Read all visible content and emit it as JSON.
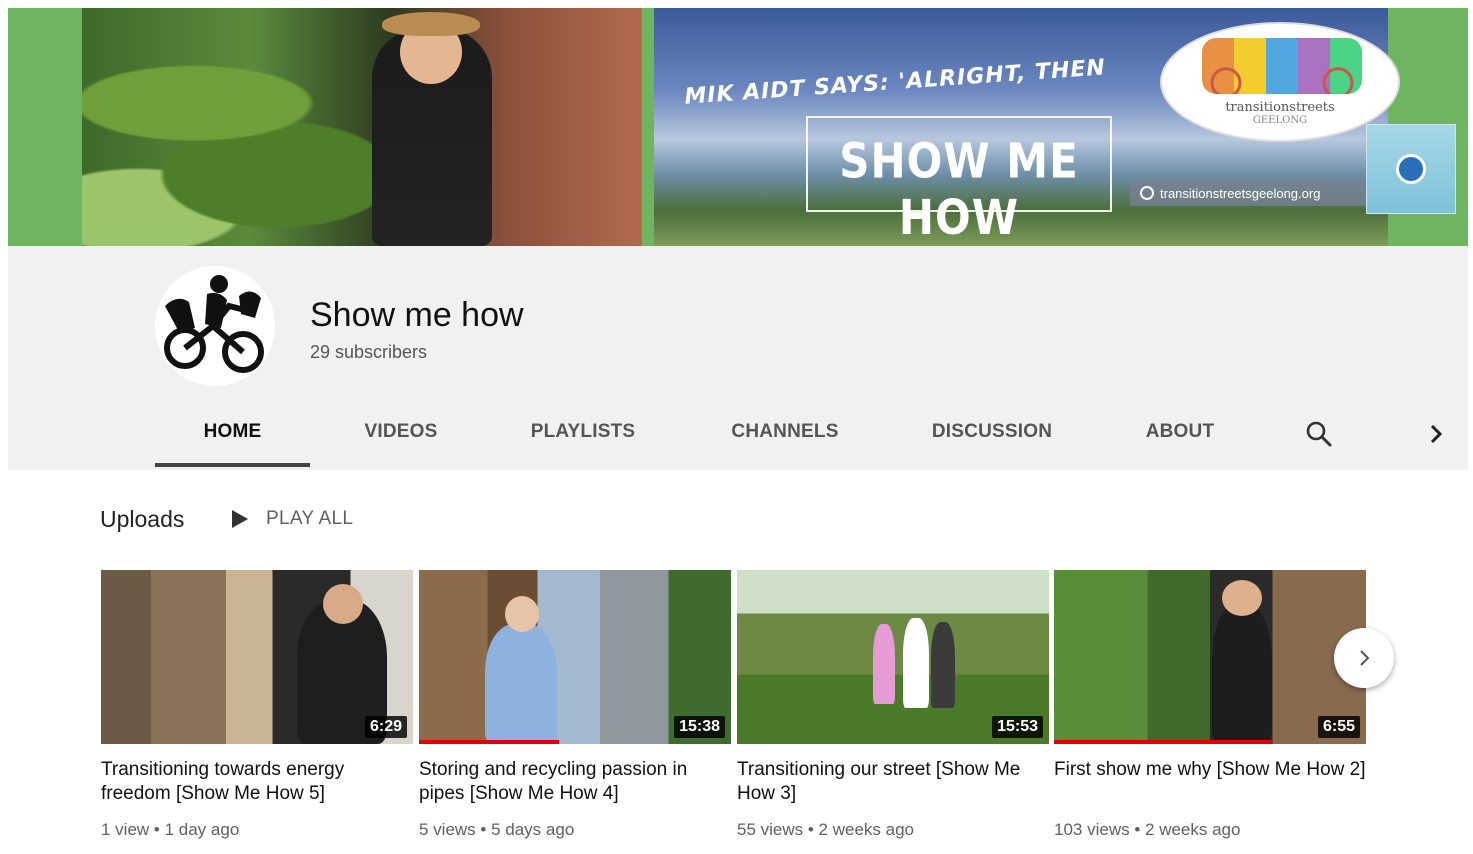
{
  "banner": {
    "tagline": "MIK AIDT SAYS: 'ALRIGHT, THEN",
    "headline": "SHOW ME HOW",
    "url": "transitionstreetsgeelong.org",
    "logo_text": "transitionstreets",
    "logo_subtext": "GEELONG"
  },
  "channel": {
    "name": "Show me how",
    "subscribers": "29 subscribers"
  },
  "tabs": [
    {
      "label": "HOME",
      "active": true
    },
    {
      "label": "VIDEOS",
      "active": false
    },
    {
      "label": "PLAYLISTS",
      "active": false
    },
    {
      "label": "CHANNELS",
      "active": false
    },
    {
      "label": "DISCUSSION",
      "active": false
    },
    {
      "label": "ABOUT",
      "active": false
    }
  ],
  "uploads": {
    "title": "Uploads",
    "play_all": "PLAY ALL",
    "videos": [
      {
        "title": "Transitioning towards energy freedom [Show Me How 5]",
        "duration": "6:29",
        "views": "1 view",
        "age": "1 day ago",
        "watched_fraction": 0
      },
      {
        "title": "Storing and recycling passion in pipes [Show Me How 4]",
        "duration": "15:38",
        "views": "5 views",
        "age": "5 days ago",
        "watched_fraction": 0.45
      },
      {
        "title": "Transitioning our street [Show Me How 3]",
        "duration": "15:53",
        "views": "55 views",
        "age": "2 weeks ago",
        "watched_fraction": 0
      },
      {
        "title": "First show me why [Show Me How 2]",
        "duration": "6:55",
        "views": "103 views",
        "age": "2 weeks ago",
        "watched_fraction": 0.7
      }
    ]
  },
  "colors": {
    "banner_green": "#6fb561",
    "header_bg": "#f1f1f1",
    "progress_red": "#e00000"
  },
  "icons": {
    "search": "search-icon",
    "next": "chevron-right-icon",
    "play": "play-icon"
  }
}
